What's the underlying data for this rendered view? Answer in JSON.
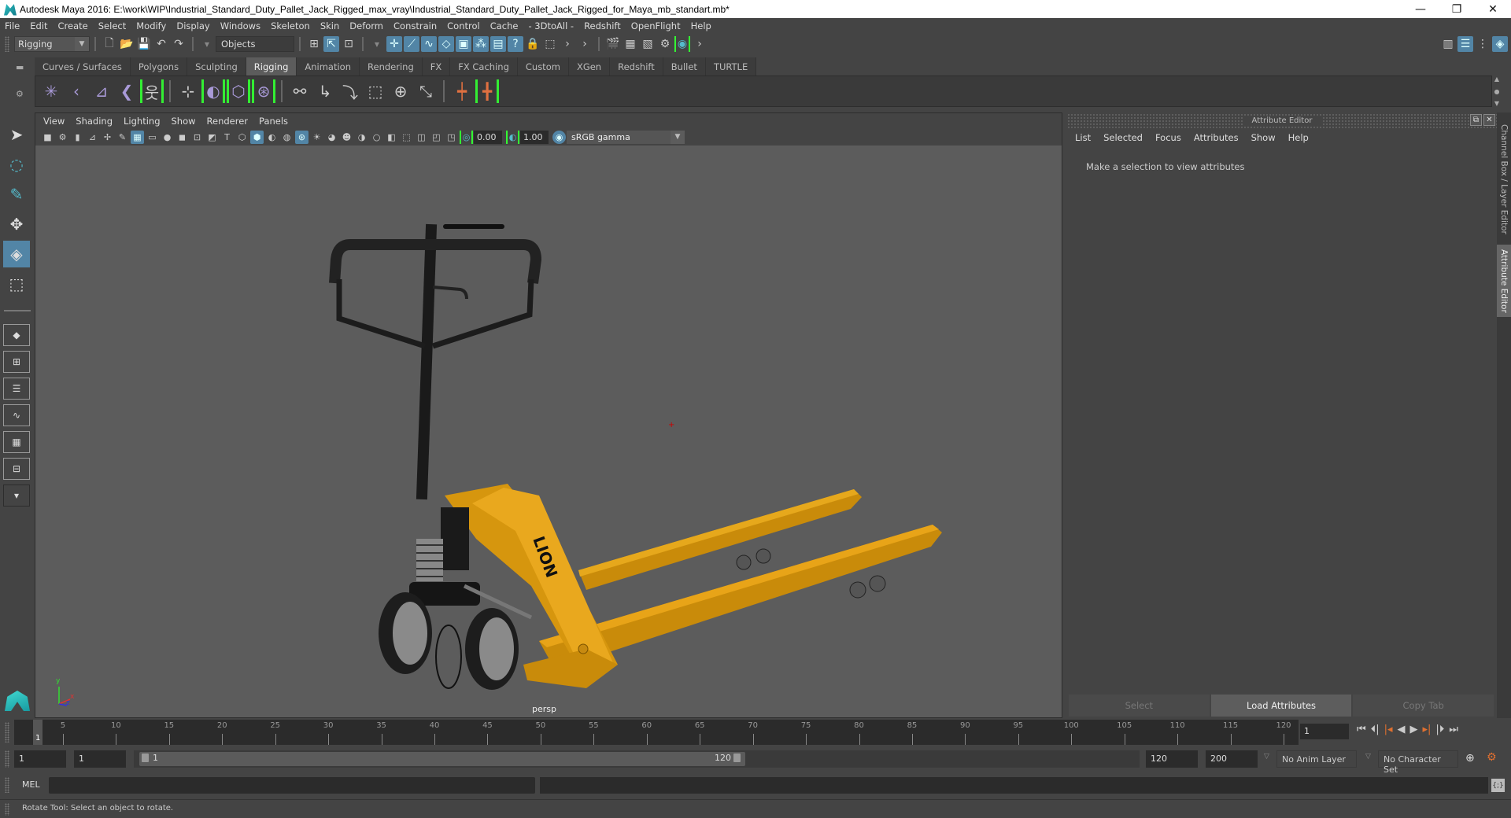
{
  "window": {
    "title": "Autodesk Maya 2016: E:\\work\\WIP\\Industrial_Standard_Duty_Pallet_Jack_Rigged_max_vray\\Industrial_Standard_Duty_Pallet_Jack_Rigged_for_Maya_mb_standart.mb*",
    "minimize": "—",
    "restore": "❐",
    "close": "✕"
  },
  "menubar": [
    "File",
    "Edit",
    "Create",
    "Select",
    "Modify",
    "Display",
    "Windows",
    "Skeleton",
    "Skin",
    "Deform",
    "Constrain",
    "Control",
    "Cache",
    "- 3DtoAll -",
    "Redshift",
    "OpenFlight",
    "Help"
  ],
  "statusline": {
    "mode": "Rigging",
    "selection_mode": "Objects"
  },
  "shelf": {
    "tabs": [
      "Curves / Surfaces",
      "Polygons",
      "Sculpting",
      "Rigging",
      "Animation",
      "Rendering",
      "FX",
      "FX Caching",
      "Custom",
      "XGen",
      "Redshift",
      "Bullet",
      "TURTLE"
    ],
    "active_tab": "Rigging",
    "icons": [
      "create-joints-icon",
      "insert-joint-icon",
      "ik-handle-icon",
      "ik-spline-icon",
      "quick-rig-icon",
      "paint-skin-weights-icon",
      "bind-skin-icon",
      "lattice-icon",
      "cluster-icon",
      "parent-constraint-icon",
      "point-constraint-icon",
      "orient-constraint-icon",
      "scale-constraint-icon",
      "aim-constraint-icon",
      "pole-vector-icon",
      "add-influence-icon",
      "hik-character-icon"
    ]
  },
  "toolbox": [
    "select-tool-icon",
    "lasso-tool-icon",
    "paint-select-icon",
    "move-tool-icon",
    "rotate-tool-icon",
    "scale-tool-icon"
  ],
  "viewport": {
    "menu": [
      "View",
      "Shading",
      "Lighting",
      "Show",
      "Renderer",
      "Panels"
    ],
    "exposure": "0.00",
    "gamma": "1.00",
    "color_space": "sRGB gamma",
    "camera_label": "persp",
    "axis": {
      "y": "y",
      "x": "x",
      "z": "z"
    }
  },
  "attribute_editor": {
    "title": "Attribute Editor",
    "menu": [
      "List",
      "Selected",
      "Focus",
      "Attributes",
      "Show",
      "Help"
    ],
    "message": "Make a selection to view attributes",
    "buttons": [
      "Select",
      "Load Attributes",
      "Copy Tab"
    ]
  },
  "side_tabs": [
    "Channel Box / Layer Editor",
    "Attribute Editor"
  ],
  "timeline": {
    "current_frame": "1",
    "ticks": [
      5,
      10,
      15,
      20,
      25,
      30,
      35,
      40,
      45,
      50,
      55,
      60,
      65,
      70,
      75,
      80,
      85,
      90,
      95,
      100,
      105,
      110,
      115,
      120
    ],
    "frame_field": "1"
  },
  "range": {
    "start": "1",
    "playback_start": "1",
    "slider_start": "1",
    "slider_end": "120",
    "playback_end": "120",
    "end": "200",
    "anim_layer": "No Anim Layer",
    "character_set": "No Character Set"
  },
  "command": {
    "label": "MEL"
  },
  "help_line": "Rotate Tool: Select an object to rotate.",
  "colors": {
    "accent": "#5285a6",
    "jack_yellow": "#e8a418",
    "viewport_bg": "#5c5c5c"
  }
}
